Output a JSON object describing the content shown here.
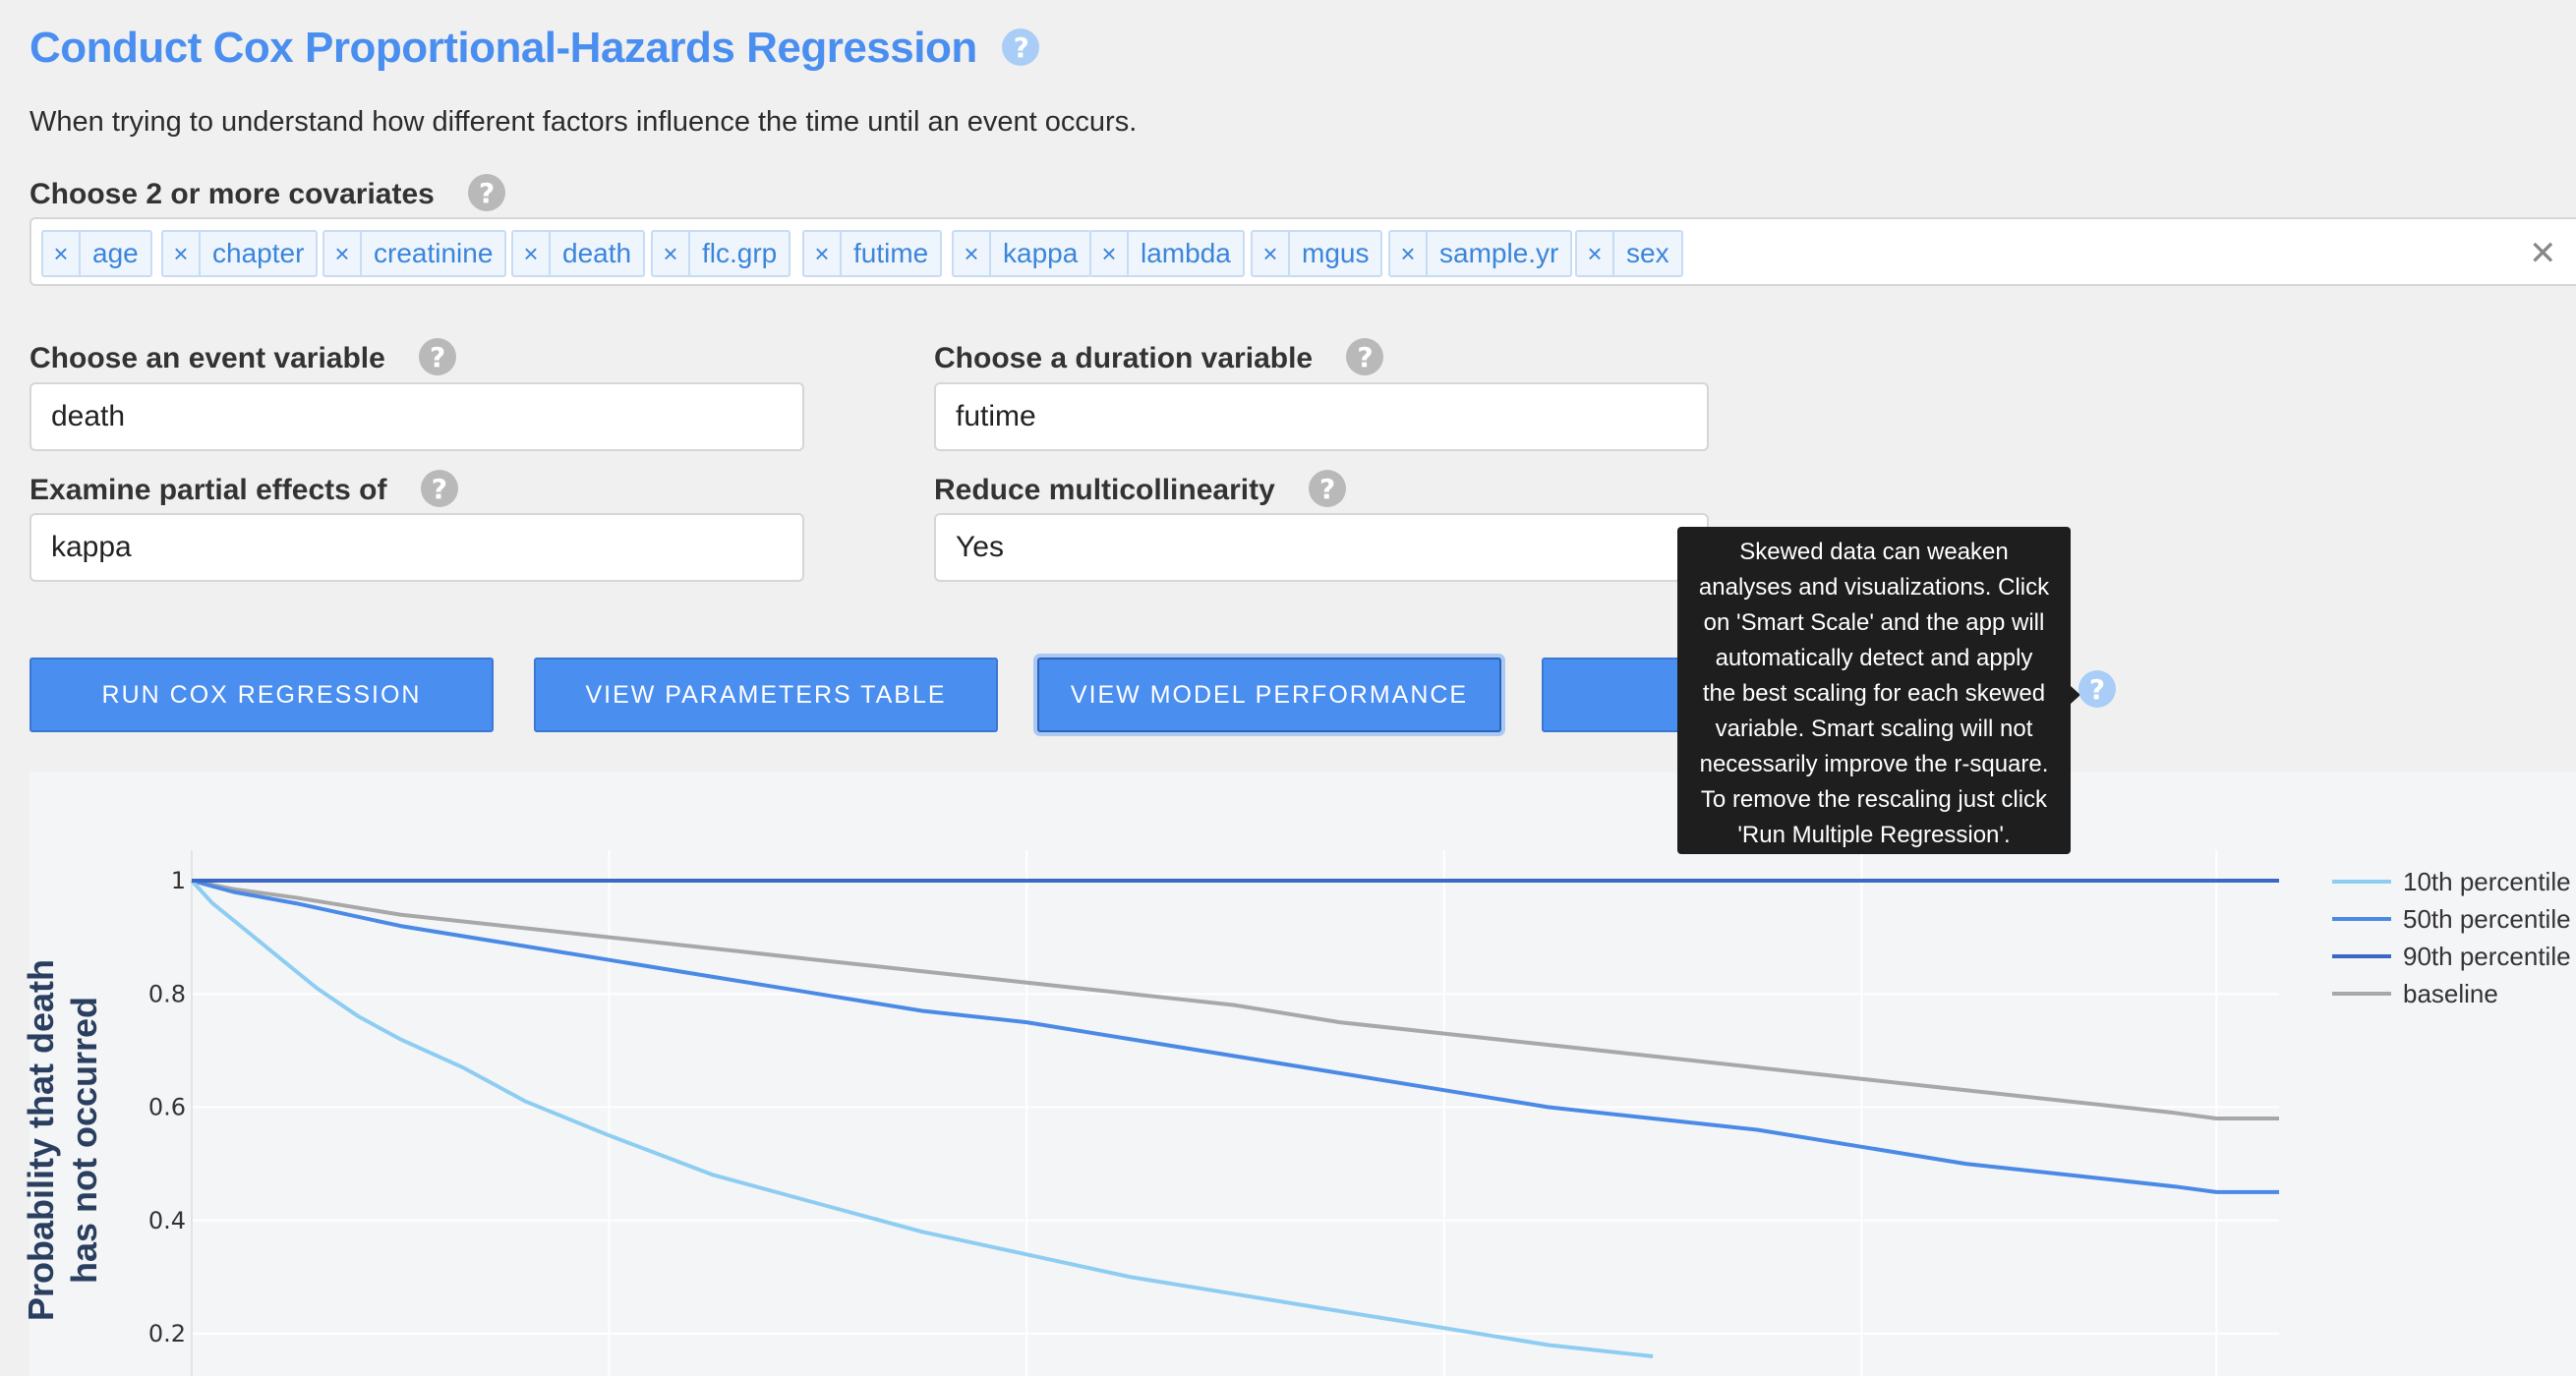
{
  "header": {
    "title": "Conduct Cox Proportional-Hazards Regression",
    "help_glyph": "?",
    "subtitle": "When trying to understand how different factors influence the time until an event occurs."
  },
  "covariates": {
    "label": "Choose 2 or more covariates",
    "remove_glyph": "×",
    "clear_glyph": "✕",
    "selected": [
      "age",
      "chapter",
      "creatinine",
      "death",
      "flc.grp",
      "futime",
      "kappa",
      "lambda",
      "mgus",
      "sample.yr",
      "sex"
    ]
  },
  "event_variable": {
    "label": "Choose an event variable",
    "value": "death"
  },
  "duration_variable": {
    "label": "Choose a duration variable",
    "value": "futime"
  },
  "partial_effects": {
    "label": "Examine partial effects of",
    "value": "kappa"
  },
  "multicollinearity": {
    "label": "Reduce multicollinearity",
    "value": "Yes"
  },
  "buttons": {
    "run": "RUN COX REGRESSION",
    "parameters": "VIEW PARAMETERS TABLE",
    "performance": "VIEW MODEL PERFORMANCE",
    "smart_scale": ""
  },
  "tooltip": {
    "lines": [
      "Skewed data can weaken",
      "analyses and visualizations. Click",
      "on 'Smart Scale' and the app will",
      "automatically detect and apply",
      "the best scaling for each skewed",
      "variable. Smart scaling will not",
      "necessarily improve the r-square.",
      "To remove the rescaling just click",
      "'Run Multiple Regression'."
    ]
  },
  "chart_data": {
    "type": "line",
    "ylabel": "Probability that death has not occurred",
    "ylabel_lines": [
      "Probability that death",
      "has not occurred"
    ],
    "xlabel": "",
    "title": "",
    "ytick_labels": [
      "1",
      "0.8",
      "0.6",
      "0.4",
      "0.2"
    ],
    "yticks": [
      1,
      0.8,
      0.6,
      0.4,
      0.2
    ],
    "ylim": [
      0.15,
      1.05
    ],
    "xlim": [
      0,
      1.0
    ],
    "grid": true,
    "legend_position": "right",
    "series": [
      {
        "name": "10th percentile",
        "color": "#8ecdf2",
        "x": [
          0,
          0.01,
          0.02,
          0.04,
          0.06,
          0.08,
          0.1,
          0.13,
          0.16,
          0.2,
          0.25,
          0.3,
          0.35,
          0.4,
          0.45,
          0.5,
          0.55,
          0.6,
          0.65,
          0.7
        ],
        "y": [
          1.0,
          0.96,
          0.93,
          0.87,
          0.81,
          0.76,
          0.72,
          0.67,
          0.61,
          0.55,
          0.48,
          0.43,
          0.38,
          0.34,
          0.3,
          0.27,
          0.24,
          0.21,
          0.18,
          0.16
        ]
      },
      {
        "name": "50th percentile",
        "color": "#4a8ae6",
        "x": [
          0,
          0.02,
          0.05,
          0.1,
          0.15,
          0.2,
          0.25,
          0.3,
          0.35,
          0.4,
          0.45,
          0.5,
          0.55,
          0.6,
          0.65,
          0.7,
          0.75,
          0.8,
          0.85,
          0.9,
          0.95,
          0.97,
          1.0
        ],
        "y": [
          1.0,
          0.98,
          0.96,
          0.92,
          0.89,
          0.86,
          0.83,
          0.8,
          0.77,
          0.75,
          0.72,
          0.69,
          0.66,
          0.63,
          0.6,
          0.58,
          0.56,
          0.53,
          0.5,
          0.48,
          0.46,
          0.45,
          0.45
        ]
      },
      {
        "name": "90th percentile",
        "color": "#3b68c4",
        "x": [
          0,
          1.0
        ],
        "y": [
          1.0,
          1.0
        ]
      },
      {
        "name": "baseline",
        "color": "#a8a8a8",
        "x": [
          0,
          0.02,
          0.05,
          0.1,
          0.15,
          0.2,
          0.25,
          0.3,
          0.35,
          0.4,
          0.45,
          0.5,
          0.55,
          0.6,
          0.65,
          0.7,
          0.75,
          0.8,
          0.85,
          0.9,
          0.95,
          0.97,
          1.0
        ],
        "y": [
          1.0,
          0.985,
          0.97,
          0.94,
          0.92,
          0.9,
          0.88,
          0.86,
          0.84,
          0.82,
          0.8,
          0.78,
          0.75,
          0.73,
          0.71,
          0.69,
          0.67,
          0.65,
          0.63,
          0.61,
          0.59,
          0.58,
          0.58
        ]
      }
    ]
  }
}
